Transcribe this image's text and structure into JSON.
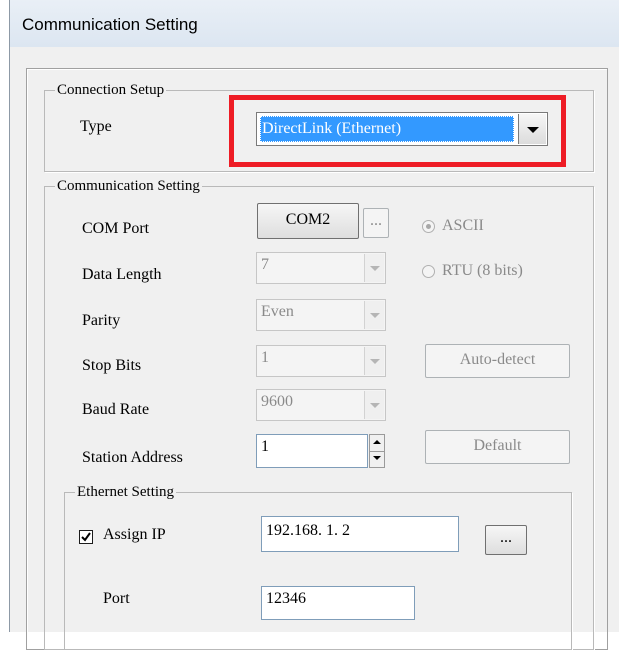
{
  "window": {
    "title": "Communication Setting"
  },
  "connection_setup": {
    "legend": "Connection Setup",
    "type_label": "Type",
    "type_value": "DirectLink (Ethernet)"
  },
  "communication": {
    "legend": "Communication Setting",
    "com_port_label": "COM Port",
    "com_port_value": "COM2",
    "browse_label": "...",
    "mode_ascii": "ASCII",
    "mode_rtu": "RTU (8 bits)",
    "mode_selected": "ASCII",
    "data_length_label": "Data Length",
    "data_length_value": "7",
    "parity_label": "Parity",
    "parity_value": "Even",
    "stop_bits_label": "Stop Bits",
    "stop_bits_value": "1",
    "auto_detect_label": "Auto-detect",
    "baud_rate_label": "Baud Rate",
    "baud_rate_value": "9600",
    "station_address_label": "Station Address",
    "station_address_value": "1",
    "default_label": "Default"
  },
  "ethernet": {
    "legend": "Ethernet Setting",
    "assign_ip_label": "Assign IP",
    "assign_ip_checked": true,
    "ip_value": "192.168.  1.  2",
    "ip_browse_label": "...",
    "port_label": "Port",
    "port_value": "12346"
  },
  "colors": {
    "highlight_box": "#ee1c25",
    "selection": "#3399ff",
    "dialog_bg": "#f0f0f0"
  }
}
